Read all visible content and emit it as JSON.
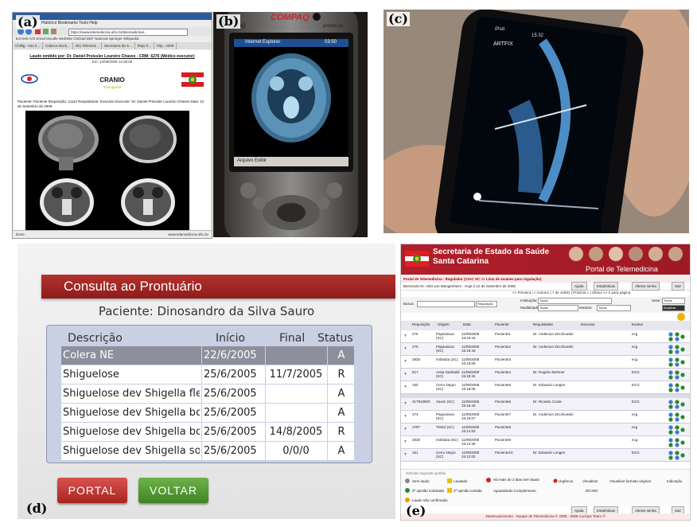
{
  "panel_labels": {
    "a": "(a)",
    "b": "(b)",
    "c": "(c)",
    "d": "(d)",
    "e": "(e)"
  },
  "panel_a": {
    "menu": "Histórico  Bookmarks  Tools  Help",
    "url": "https://www.telemedicina.ufsc.br/telemedicina/...",
    "favorites": "EXAMS IVS Email   Moodle   WebSite   CbGlad   DEF   National   Springer   Wikipedia",
    "tabs": [
      "Chillig - Isto é...",
      "Cabeca Duck...",
      "Isto Telemed...",
      "Secretaria da S...",
      "https://...",
      "http...4299"
    ],
    "author": "Laudo emitido por: Dr. Daniel Preissler Loureiro Chaves - CRM: 6276 (Médico executor)",
    "emitted": "Em: 12/09/2008 14:39:08",
    "exam_title": "CRANIO",
    "exam_sub": "Tomografia",
    "patient_line": "Paciente: Paciente    Requisição: 11112    Requisitante: EvaAmin    Executor: Dr. Daniel Preissler Loureiro Chaves    Data: 12 de Setembro de 2008",
    "status_left": "Done",
    "status_right": "www.telemedicina.ufsc.br"
  },
  "panel_b": {
    "brand": "COMPAQ",
    "model": "iPAQ",
    "pocket": "pocket pc",
    "browser_title": "Internet Explorer",
    "time": "03:50",
    "toolbar": "Arquivo  Exibir"
  },
  "panel_c": {
    "carrier": "iPod",
    "time": "15:32",
    "app": "ARTFIX"
  },
  "panel_d": {
    "title": "Consulta ao Prontuário",
    "patient": "Paciente: Dinosandro da Silva Sauro",
    "columns": [
      "Descrição",
      "Início",
      "Final",
      "Status"
    ],
    "rows": [
      {
        "desc": "Colera NE",
        "start": "22/6/2005",
        "end": "",
        "status": "A"
      },
      {
        "desc": "Shiguelose",
        "start": "25/6/2005",
        "end": "11/7/2005",
        "status": "R"
      },
      {
        "desc": "Shiguelose dev Shigella flexn",
        "start": "25/6/2005",
        "end": "",
        "status": "A"
      },
      {
        "desc": "Shiguelose dev Shigella boyd",
        "start": "25/6/2005",
        "end": "",
        "status": "A"
      },
      {
        "desc": "Shiguelose dev Shigella boyd",
        "start": "25/6/2005",
        "end": "14/8/2005",
        "status": "R"
      },
      {
        "desc": "Shiguelose dev Shigella sonn",
        "start": "25/6/2005",
        "end": "0/0/0",
        "status": "A"
      }
    ],
    "btn_portal": "PORTAL",
    "btn_voltar": "VOLTAR"
  },
  "panel_e": {
    "title1": "Secretaria de Estado da Saúde",
    "title2": "Santa Catarina",
    "portal": "Portal de Telemedicina",
    "crumb": "Portal de Telemedicina - Regulador (CIAC SC >> Lista de exames para regulação)",
    "user": "Bemvindo Dr. Aldo von Wangenheim - Hoje é 12 de Setembro de 2008",
    "btn_help": "Ajuda",
    "btn_stats": "Estatísticas",
    "btn_pass": "Alterar senha",
    "btn_exit": "Sair",
    "pager": "<< Primeira  |  « Anterior  |  7 de 10091  |  Próxima »  |  Última >>   Ir para página",
    "search_label": "Busca:",
    "search_select": "Requisição",
    "inst_label": "Instituição:",
    "inst_value": "Todos",
    "mod_label": "Modalidade:",
    "mod_value": "Todas",
    "show_label": "Mostrar:",
    "show_value": "Todos",
    "sector_label": "Setor:",
    "sector_value": "Todos",
    "update": "Atualizar",
    "headers": [
      "Requisição",
      "Origem",
      "Data",
      "Paciente",
      "Requisitante",
      "Executor",
      "Exame"
    ],
    "rows": [
      {
        "req": "376",
        "origin": "Papanduva (SC)",
        "date": "11/09/2008 15:23:18",
        "patient": "Paciente1",
        "requester": "Dr. Anderson Zeczkowski",
        "exam": "ecg"
      },
      {
        "req": "275",
        "origin": "Papanduva (SC)",
        "date": "11/09/2008 15:19:43",
        "patient": "Paciente2",
        "requester": "Dr. Anderson Zeczkowski",
        "exam": "ecg"
      },
      {
        "req": "3935",
        "origin": "Imbituba (SC)",
        "date": "11/09/2008 15:18:09",
        "patient": "Paciente3",
        "requester": "",
        "exam": "ecg"
      },
      {
        "req": "517",
        "origin": "Anita Garibaldi (SC)",
        "date": "11/09/2008 15:18:34",
        "patient": "Paciente4",
        "requester": "Dr. Rogério Behmer",
        "exam": "ECG"
      },
      {
        "req": "150",
        "origin": "Cerro Negro (SC)",
        "date": "11/09/2008 15:18:06",
        "patient": "Paciente5",
        "requester": "Dr. Eduardo Longen",
        "exam": "ECG"
      },
      {
        "req": "317910800",
        "origin": "Xaxim (SC)",
        "date": "11/09/2008 15:16:40",
        "patient": "Paciente6",
        "requester": "Dr. Ricardo Costa",
        "exam": "ECG"
      },
      {
        "req": "374",
        "origin": "Papanduva (SC)",
        "date": "11/09/2008 15:16:07",
        "patient": "Paciente7",
        "requester": "Dr. Anderson Zeczkowski",
        "exam": "ecg"
      },
      {
        "req": "1787",
        "origin": "Timbó (SC)",
        "date": "11/09/2008 15:14:53",
        "patient": "Paciente8",
        "requester": "",
        "exam": "ecg"
      },
      {
        "req": "3930",
        "origin": "Imbituba (SC)",
        "date": "11/09/2008 15:14:48",
        "patient": "Paciente9",
        "requester": "",
        "exam": "ecg"
      },
      {
        "req": "151",
        "origin": "Cerro Negro (SC)",
        "date": "11/09/2008 15:12:02",
        "patient": "Paciente10",
        "requester": "Dr. Eduardo Longen",
        "exam": "ECG"
      }
    ],
    "legend": {
      "sem_laudo": "Sem laudo",
      "laudado": "Laudado",
      "mais3dias": "Há mais de 3 dias sem laudo",
      "urgencia": "Urgência",
      "visualizar": "Visualizar",
      "formato": "Visualizar formato original",
      "indicacao": "Indicação",
      "segunda_solic": "2ª opinião solicitada",
      "segunda_emit": "2ª opinião emitida",
      "aguardando": "Aguardando Complemento",
      "dicom": "DICOM",
      "nao_conf": "Laudo não confirmado",
      "solicitar": "Solicitar segunda opinião"
    },
    "footer": "Desenvolvimento - Equipe de Telemedicina © 2005 - 2008 Cyclops Team ®"
  }
}
